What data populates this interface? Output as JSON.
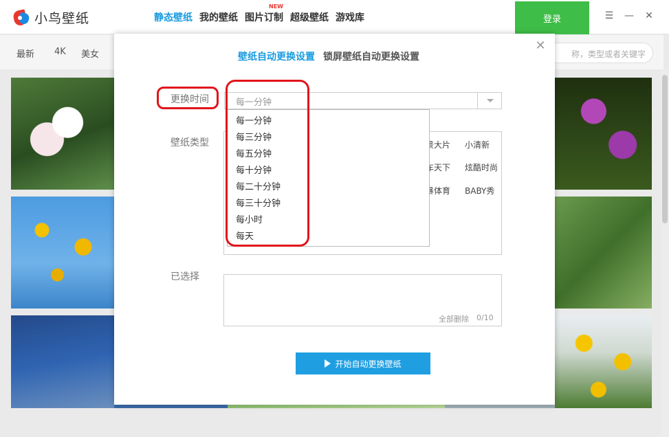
{
  "app": {
    "logo_text": "小鸟壁纸",
    "nav": [
      {
        "label": "静态壁纸",
        "active": true
      },
      {
        "label": "我的壁纸",
        "active": false
      },
      {
        "label": "图片订制",
        "active": false,
        "badge": "NEW"
      },
      {
        "label": "超级壁纸",
        "active": false
      },
      {
        "label": "游戏库",
        "active": false
      }
    ],
    "login_label": "登录",
    "window_controls": [
      "menu-icon",
      "minimize-icon",
      "close-icon"
    ]
  },
  "categories": {
    "items": [
      "最新",
      "4K",
      "美女"
    ],
    "search_placeholder": "称，类型或者关键字"
  },
  "dialog": {
    "tabs": [
      "壁纸自动更换设置",
      "锁屏壁纸自动更换设置"
    ],
    "interval_label": "更换时间",
    "interval_value": "每一分钟",
    "interval_options": [
      "每一分钟",
      "每三分钟",
      "每五分钟",
      "每十分钟",
      "每二十分钟",
      "每三十分钟",
      "每小时",
      "每天"
    ],
    "type_label": "壁纸类型",
    "types": [
      "景大片",
      "小清新",
      "车天下",
      "炫酷时尚",
      "暴体育",
      "BABY秀"
    ],
    "selected_label": "已选择",
    "clear_all": "全部删除",
    "count": "0/10",
    "start_button": "开始自动更换壁纸"
  },
  "colors": {
    "accent": "#1a9be0",
    "login_green": "#3ebd48",
    "annotation_red": "#e1141b",
    "new_badge": "#e8382f"
  }
}
